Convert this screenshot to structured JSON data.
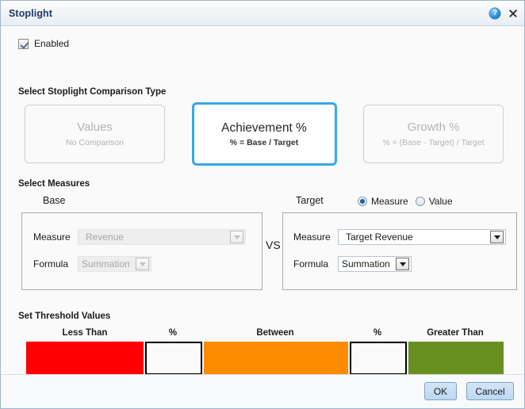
{
  "window": {
    "title": "Stoplight",
    "help_icon": "help-circle-icon",
    "close_icon": "close-icon"
  },
  "enabled": {
    "label": "Enabled",
    "checked": true
  },
  "comparison": {
    "section_title": "Select Stoplight Comparison Type",
    "selected": "Achievement %",
    "options": [
      {
        "title": "Values",
        "subtitle": "No Comparison",
        "selected": false
      },
      {
        "title": "Achievement %",
        "subtitle": "% = Base / Target",
        "selected": true
      },
      {
        "title": "Growth %",
        "subtitle": "% = (Base - Target) / Target",
        "selected": false
      }
    ]
  },
  "measures": {
    "section_title": "Select Measures",
    "vs_label": "VS",
    "base": {
      "heading": "Base",
      "enabled": false,
      "measure_label": "Measure",
      "measure_value": "Revenue",
      "formula_label": "Formula",
      "formula_value": "Summation"
    },
    "target": {
      "heading": "Target",
      "enabled": true,
      "mode_measure_label": "Measure",
      "mode_value_label": "Value",
      "mode_selected": "Measure",
      "measure_label": "Measure",
      "measure_value": "Target Revenue",
      "formula_label": "Formula",
      "formula_value": "Summation"
    }
  },
  "thresholds": {
    "section_title": "Set Threshold Values",
    "headers": {
      "less_than": "Less Than",
      "percent_left": "%",
      "between": "Between",
      "percent_right": "%",
      "greater_than": "Greater Than"
    },
    "low_value": "",
    "high_value": "",
    "input_placeholder": "",
    "colors": {
      "low": "#FF0000",
      "mid": "#FF8C00",
      "high": "#689021"
    }
  },
  "footer": {
    "ok_label": "OK",
    "cancel_label": "Cancel"
  },
  "theme": {
    "accent": "#35A8E8",
    "title_color": "#1F3864"
  }
}
